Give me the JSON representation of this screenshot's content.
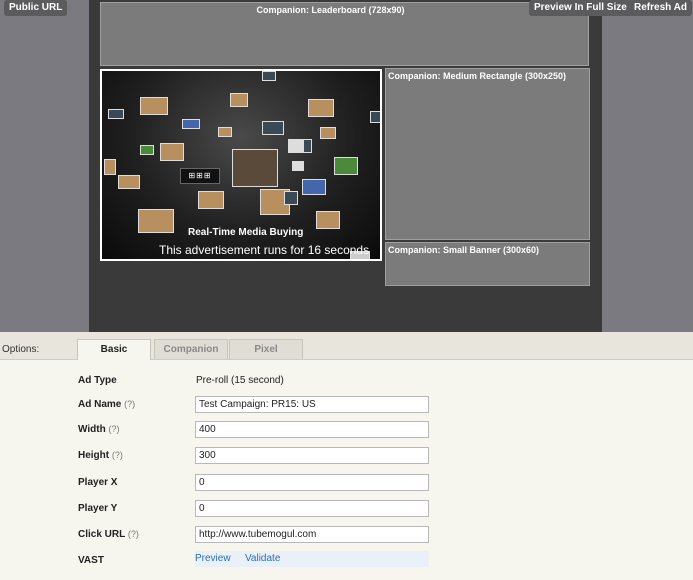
{
  "toolbar": {
    "public_url": "Public URL",
    "preview_full": "Preview In Full Size",
    "refresh_ad": "Refresh Ad"
  },
  "companions": {
    "leaderboard": "Companion: Leaderboard (728x90)",
    "medium_rect": "Companion: Medium Rectangle (300x250)",
    "small_banner": "Companion: Small Banner (300x60)"
  },
  "player": {
    "title": "Real-Time Media Buying",
    "caption": "This advertisement runs for 16 seconds"
  },
  "options": {
    "label": "Options:",
    "tabs": [
      "Basic",
      "Companion",
      "Pixel"
    ],
    "active_tab": "Basic"
  },
  "form": {
    "ad_type_label": "Ad Type",
    "ad_type_value": "Pre-roll (15 second)",
    "ad_name_label": "Ad Name",
    "ad_name_value": "Test Campaign: PR15: US",
    "width_label": "Width",
    "width_value": "400",
    "height_label": "Height",
    "height_value": "300",
    "player_x_label": "Player X",
    "player_x_value": "0",
    "player_y_label": "Player Y",
    "player_y_value": "0",
    "click_url_label": "Click URL",
    "click_url_value": "http://www.tubemogul.com",
    "vast_label": "VAST",
    "vast_preview": "Preview",
    "vast_validate": "Validate",
    "help_hint": "(?)"
  }
}
